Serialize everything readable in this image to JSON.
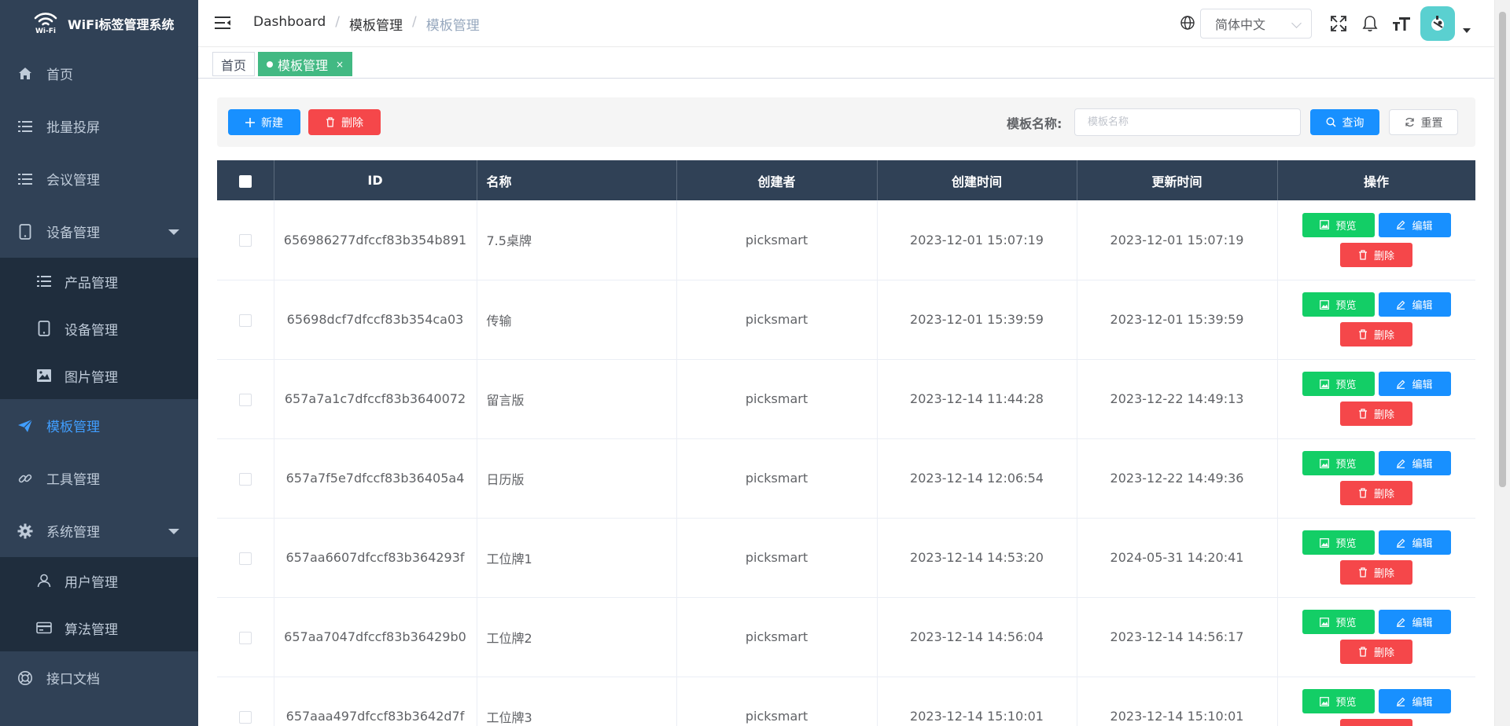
{
  "app": {
    "title": "WiFi标签管理系统",
    "logo_text": "Wi-Fi"
  },
  "sidebar": {
    "items": [
      {
        "label": "首页",
        "icon": "home-icon"
      },
      {
        "label": "批量投屏",
        "icon": "list-icon"
      },
      {
        "label": "会议管理",
        "icon": "list-icon"
      },
      {
        "label": "设备管理",
        "icon": "tablet-icon",
        "expanded": true,
        "children": [
          {
            "label": "产品管理",
            "icon": "list-icon"
          },
          {
            "label": "设备管理",
            "icon": "tablet-icon"
          },
          {
            "label": "图片管理",
            "icon": "image-icon"
          }
        ]
      },
      {
        "label": "模板管理",
        "icon": "send-icon",
        "active": true
      },
      {
        "label": "工具管理",
        "icon": "link-icon"
      },
      {
        "label": "系统管理",
        "icon": "gear-icon",
        "expanded": true,
        "children": [
          {
            "label": "用户管理",
            "icon": "user-icon"
          },
          {
            "label": "算法管理",
            "icon": "card-icon"
          }
        ]
      },
      {
        "label": "接口文档",
        "icon": "lifebuoy-icon"
      }
    ]
  },
  "navbar": {
    "breadcrumb": [
      "Dashboard",
      "模板管理",
      "模板管理"
    ],
    "language": "简体中文"
  },
  "tags": [
    {
      "label": "首页",
      "active": false
    },
    {
      "label": "模板管理",
      "active": true,
      "close": "×"
    }
  ],
  "toolbar": {
    "new_label": "新建",
    "delete_label": "删除",
    "search_label": "模板名称:",
    "search_placeholder": "模板名称",
    "query_label": "查询",
    "reset_label": "重置"
  },
  "table": {
    "columns": [
      "ID",
      "名称",
      "创建者",
      "创建时间",
      "更新时间",
      "操作"
    ],
    "actions": {
      "preview": "预览",
      "edit": "编辑",
      "delete": "删除"
    },
    "rows": [
      {
        "id": "656986277dfccf83b354b891",
        "name": "7.5桌牌",
        "creator": "picksmart",
        "created": "2023-12-01 15:07:19",
        "updated": "2023-12-01 15:07:19"
      },
      {
        "id": "65698dcf7dfccf83b354ca03",
        "name": "传输",
        "creator": "picksmart",
        "created": "2023-12-01 15:39:59",
        "updated": "2023-12-01 15:39:59"
      },
      {
        "id": "657a7a1c7dfccf83b3640072",
        "name": "留言版",
        "creator": "picksmart",
        "created": "2023-12-14 11:44:28",
        "updated": "2023-12-22 14:49:13"
      },
      {
        "id": "657a7f5e7dfccf83b36405a4",
        "name": "日历版",
        "creator": "picksmart",
        "created": "2023-12-14 12:06:54",
        "updated": "2023-12-22 14:49:36"
      },
      {
        "id": "657aa6607dfccf83b364293f",
        "name": "工位牌1",
        "creator": "picksmart",
        "created": "2023-12-14 14:53:20",
        "updated": "2024-05-31 14:20:41"
      },
      {
        "id": "657aa7047dfccf83b36429b0",
        "name": "工位牌2",
        "creator": "picksmart",
        "created": "2023-12-14 14:56:04",
        "updated": "2023-12-14 14:56:17"
      },
      {
        "id": "657aaa497dfccf83b3642d7f",
        "name": "工位牌3",
        "creator": "picksmart",
        "created": "2023-12-14 15:10:01",
        "updated": "2023-12-14 15:10:01"
      }
    ]
  },
  "colors": {
    "sidebar_bg": "#304156",
    "submenu_bg": "#1f2d3d",
    "accent": "#409eff",
    "primary": "#1890ff",
    "success": "#13ce66",
    "danger": "#f5474a",
    "tag_active": "#42b983"
  }
}
